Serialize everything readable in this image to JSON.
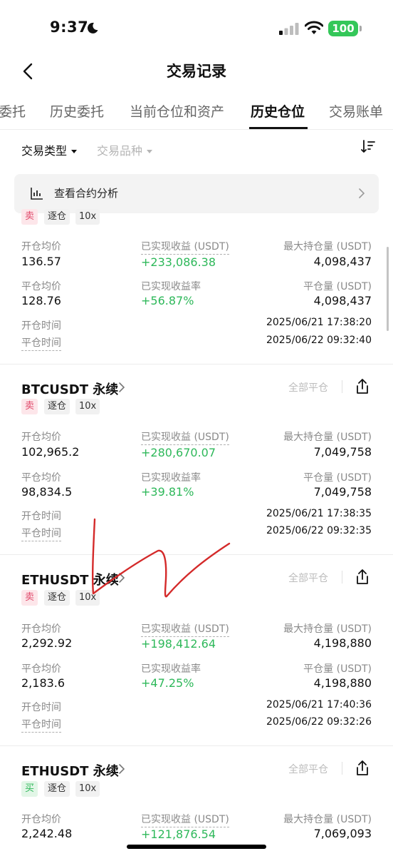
{
  "status_bar": {
    "time": "9:37",
    "battery": "100"
  },
  "nav": {
    "title": "交易记录"
  },
  "tabs": [
    {
      "label": "委托"
    },
    {
      "label": "历史委托"
    },
    {
      "label": "当前仓位和资产"
    },
    {
      "label": "历史仓位"
    },
    {
      "label": "交易账单"
    }
  ],
  "active_tab": "历史仓位",
  "filters": {
    "type_label": "交易类型",
    "kind_label": "交易品种"
  },
  "analysis": {
    "label": "查看合约分析"
  },
  "field_labels": {
    "open_avg": "开仓均价",
    "realized_pnl": "已实现收益 (USDT)",
    "max_position": "最大持仓量 (USDT)",
    "close_avg": "平仓均价",
    "realized_rate": "已实现收益率",
    "close_amount": "平仓量 (USDT)",
    "open_time": "开仓时间",
    "close_time": "平仓时间",
    "close_all": "全部平仓"
  },
  "records": [
    {
      "symbol": "",
      "side": "卖",
      "margin": "逐仓",
      "leverage": "10x",
      "open_avg": "136.57",
      "realized_pnl": "+233,086.38",
      "max_position": "4,098,437",
      "close_avg": "128.76",
      "realized_rate": "+56.87%",
      "close_amount": "4,098,437",
      "open_time": "2025/06/21 17:38:20",
      "close_time": "2025/06/22 09:32:40"
    },
    {
      "symbol": "BTCUSDT 永续",
      "side": "卖",
      "margin": "逐仓",
      "leverage": "10x",
      "open_avg": "102,965.2",
      "realized_pnl": "+280,670.07",
      "max_position": "7,049,758",
      "close_avg": "98,834.5",
      "realized_rate": "+39.81%",
      "close_amount": "7,049,758",
      "open_time": "2025/06/21 17:38:35",
      "close_time": "2025/06/22 09:32:35"
    },
    {
      "symbol": "ETHUSDT 永续",
      "side": "卖",
      "margin": "逐仓",
      "leverage": "10x",
      "open_avg": "2,292.92",
      "realized_pnl": "+198,412.64",
      "max_position": "4,198,880",
      "close_avg": "2,183.6",
      "realized_rate": "+47.25%",
      "close_amount": "4,198,880",
      "open_time": "2025/06/21 17:40:36",
      "close_time": "2025/06/22 09:32:26"
    },
    {
      "symbol": "ETHUSDT 永续",
      "side": "买",
      "margin": "逐仓",
      "leverage": "10x",
      "open_avg": "2,242.48",
      "realized_pnl": "+121,876.54",
      "max_position": "7,069,093"
    }
  ],
  "colors": {
    "profit_green": "#2eb85a",
    "sell_red": "#e0486a",
    "battery_green": "#34c759",
    "annotation_red": "#d42a2a"
  }
}
